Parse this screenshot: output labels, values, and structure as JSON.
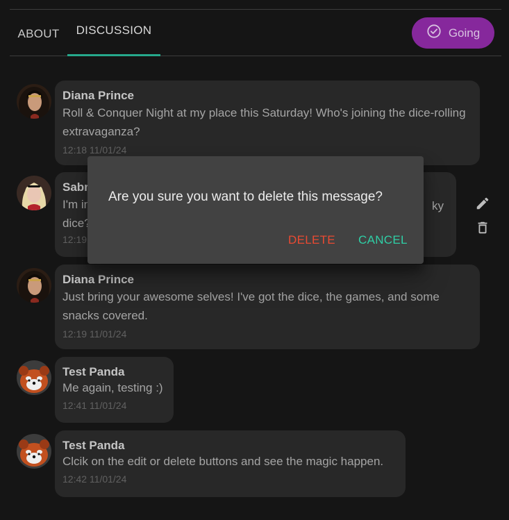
{
  "tabs": {
    "about": "ABOUT",
    "discussion": "DISCUSSION"
  },
  "going_button": {
    "label": "Going",
    "icon": "check-circle-icon",
    "color": "#86289c"
  },
  "messages": [
    {
      "author": "Diana Prince",
      "text": "Roll & Conquer Night at my place this Saturday! Who's joining the dice-rolling extravaganza?",
      "time": "12:18 11/01/24",
      "avatar": "diana-avatar"
    },
    {
      "author": "Sabrina",
      "author_visible": "Sabr",
      "text_visible_a": "I'm in",
      "text_visible_b": "dice?",
      "text_tail": "ky",
      "time_visible": "12:19",
      "avatar": "sabrina-avatar"
    },
    {
      "author": "Diana Prince",
      "text": "Just bring your awesome selves! I've got the dice, the games, and some snacks covered.",
      "time": "12:19 11/01/24",
      "avatar": "diana-avatar"
    },
    {
      "author": "Test Panda",
      "text": "Me again, testing :)",
      "time": "12:41 11/01/24",
      "avatar": "panda-avatar"
    },
    {
      "author": "Test Panda",
      "text": "Clcik on the edit or delete buttons and see the magic happen.",
      "time": "12:42 11/01/24",
      "avatar": "panda-avatar"
    }
  ],
  "message_actions": {
    "edit_icon": "pencil-icon",
    "delete_icon": "trash-icon"
  },
  "dialog": {
    "question": "Are you sure you want to delete this message?",
    "delete_label": "DELETE",
    "cancel_label": "CANCEL",
    "delete_color": "#ea4a32",
    "cancel_color": "#2fcfa6"
  },
  "colors": {
    "accent": "#26a98c",
    "background": "#151515",
    "bubble": "#282828"
  }
}
